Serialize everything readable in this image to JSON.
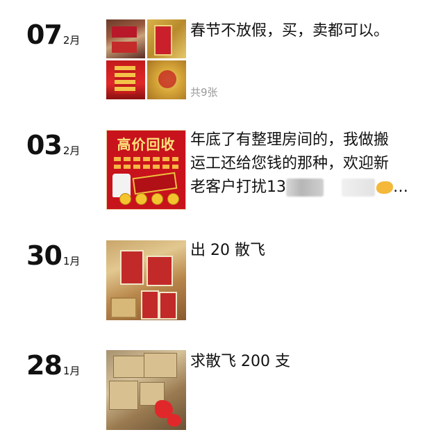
{
  "posts": [
    {
      "day": "07",
      "month": "2月",
      "text": "春节不放假，买，卖都可以。",
      "count": "共9张",
      "thumb": "collage-icon"
    },
    {
      "day": "03",
      "month": "2月",
      "text_line1": "年底了有整理房间的，我做搬",
      "text_line2": "运工还给您钱的那种，欢迎新",
      "text_line3": "老客户打扰13",
      "ellipsis": "…",
      "poster_title": "高价回收",
      "thumb": "promo-poster-icon"
    },
    {
      "day": "30",
      "month": "1月",
      "text": "出 20 散飞",
      "thumb": "warehouse-photo-icon"
    },
    {
      "day": "28",
      "month": "1月",
      "text": "求散飞 200 支",
      "thumb": "boxes-photo-icon"
    }
  ],
  "colors": {
    "text": "#111111",
    "muted": "#9a9a9a",
    "poster_red": "#c8121c",
    "poster_gold": "#ffe27a"
  }
}
